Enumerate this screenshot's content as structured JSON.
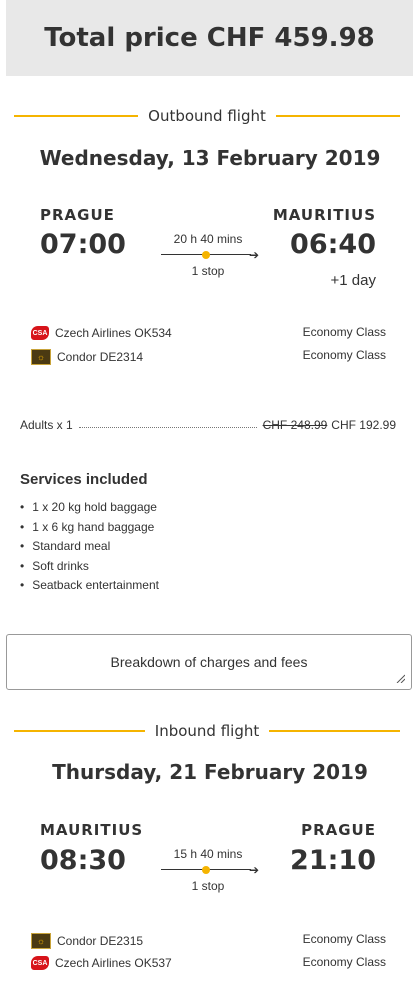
{
  "total": {
    "label": "Total price CHF 459.98"
  },
  "outbound": {
    "heading": "Outbound flight",
    "date": "Wednesday, 13 February 2019",
    "from_city": "PRAGUE",
    "from_time": "07:00",
    "to_city": "MAURITIUS",
    "to_time": "06:40",
    "plus_day": "+1 day",
    "duration": "20 h 40 mins",
    "stops": "1 stop",
    "segments": [
      {
        "airline": "Czech Airlines OK534",
        "class": "Economy Class",
        "logo": "czech-airlines-logo"
      },
      {
        "airline": "Condor DE2314",
        "class": "Economy Class",
        "logo": "condor-logo"
      }
    ]
  },
  "passengers": {
    "label": "Adults x 1",
    "old_price": "CHF 248.99",
    "new_price": "CHF 192.99"
  },
  "services": {
    "title": "Services included",
    "items": [
      "1 x 20 kg hold baggage",
      "1 x 6 kg hand baggage",
      "Standard meal",
      "Soft drinks",
      "Seatback entertainment"
    ]
  },
  "breakdown": {
    "label": "Breakdown of charges and fees"
  },
  "inbound": {
    "heading": "Inbound flight",
    "date": "Thursday, 21 February 2019",
    "from_city": "MAURITIUS",
    "from_time": "08:30",
    "to_city": "PRAGUE",
    "to_time": "21:10",
    "duration": "15 h 40 mins",
    "stops": "1 stop",
    "segments": [
      {
        "airline": "Condor DE2315",
        "class": "Economy Class",
        "logo": "condor-logo"
      },
      {
        "airline": "Czech Airlines OK537",
        "class": "Economy Class",
        "logo": "czech-airlines-logo"
      }
    ]
  },
  "colors": {
    "accent": "#f5b400",
    "header_bg": "#e8e8e8",
    "text": "#333333",
    "czech_red": "#d7141a"
  }
}
